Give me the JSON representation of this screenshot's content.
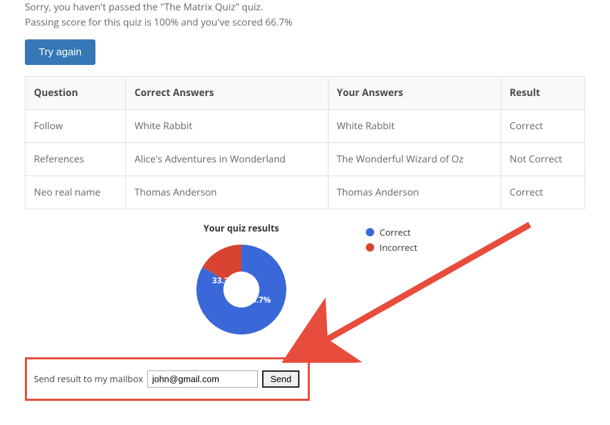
{
  "message": {
    "line1": "Sorry, you haven't passed the \"The Matrix Quiz\" quiz.",
    "line2": "Passing score for this quiz is 100% and you've scored 66.7%"
  },
  "buttons": {
    "try_again": "Try again",
    "send": "Send"
  },
  "table": {
    "headers": {
      "question": "Question",
      "correct_answers": "Correct Answers",
      "your_answers": "Your Answers",
      "result": "Result"
    },
    "rows": [
      {
        "question": "Follow",
        "correct": "White Rabbit",
        "your": "White Rabbit",
        "result": "Correct",
        "result_class": "result-correct"
      },
      {
        "question": "References",
        "correct": "Alice's Adventures in Wonderland",
        "your": "The Wonderful Wizard of Oz",
        "result": "Not Correct",
        "result_class": "result-incorrect"
      },
      {
        "question": "Neo real name",
        "correct": "Thomas Anderson",
        "your": "Thomas Anderson",
        "result": "Correct",
        "result_class": "result-correct"
      }
    ]
  },
  "chart": {
    "title": "Your quiz results",
    "legend": {
      "correct": "Correct",
      "incorrect": "Incorrect"
    },
    "labels": {
      "correct_pct": "66.7%",
      "incorrect_pct": "33.3%"
    }
  },
  "chart_data": {
    "type": "pie",
    "title": "Your quiz results",
    "categories": [
      "Correct",
      "Incorrect"
    ],
    "values": [
      66.7,
      33.3
    ],
    "colors": [
      "#3a68d8",
      "#d94331"
    ]
  },
  "send_form": {
    "label": "Send result to my mailbox",
    "email_value": "john@gmail.com"
  },
  "colors": {
    "correct_slice": "#3a68d8",
    "incorrect_slice": "#d94331",
    "highlight_border": "#e74c3c"
  }
}
